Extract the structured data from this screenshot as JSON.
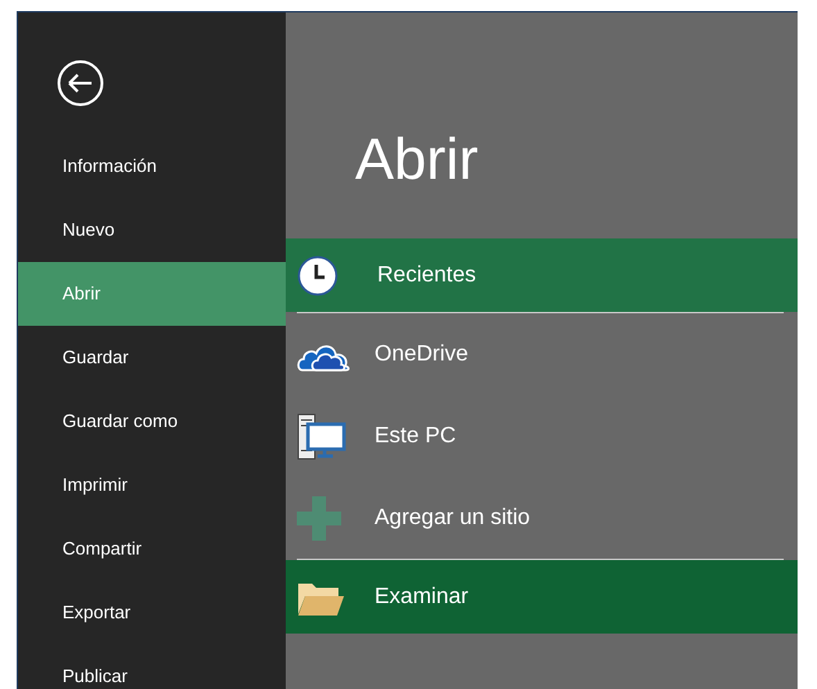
{
  "sidebar": {
    "items": [
      {
        "label": "Información",
        "selected": false
      },
      {
        "label": "Nuevo",
        "selected": false
      },
      {
        "label": "Abrir",
        "selected": true
      },
      {
        "label": "Guardar",
        "selected": false
      },
      {
        "label": "Guardar como",
        "selected": false
      },
      {
        "label": "Imprimir",
        "selected": false
      },
      {
        "label": "Compartir",
        "selected": false
      },
      {
        "label": "Exportar",
        "selected": false
      },
      {
        "label": "Publicar",
        "selected": false
      }
    ]
  },
  "title": "Abrir",
  "location_groups": [
    [
      {
        "kind": "clock",
        "label": "Recientes",
        "selected": true,
        "hovered": false
      }
    ],
    [
      {
        "kind": "cloud",
        "label": "OneDrive",
        "selected": false,
        "hovered": false
      },
      {
        "kind": "computer",
        "label": "Este PC",
        "selected": false,
        "hovered": false
      },
      {
        "kind": "add",
        "label": "Agregar un sitio",
        "selected": false,
        "hovered": false
      }
    ],
    [
      {
        "kind": "folder",
        "label": "Examinar",
        "selected": false,
        "hovered": true
      }
    ]
  ]
}
